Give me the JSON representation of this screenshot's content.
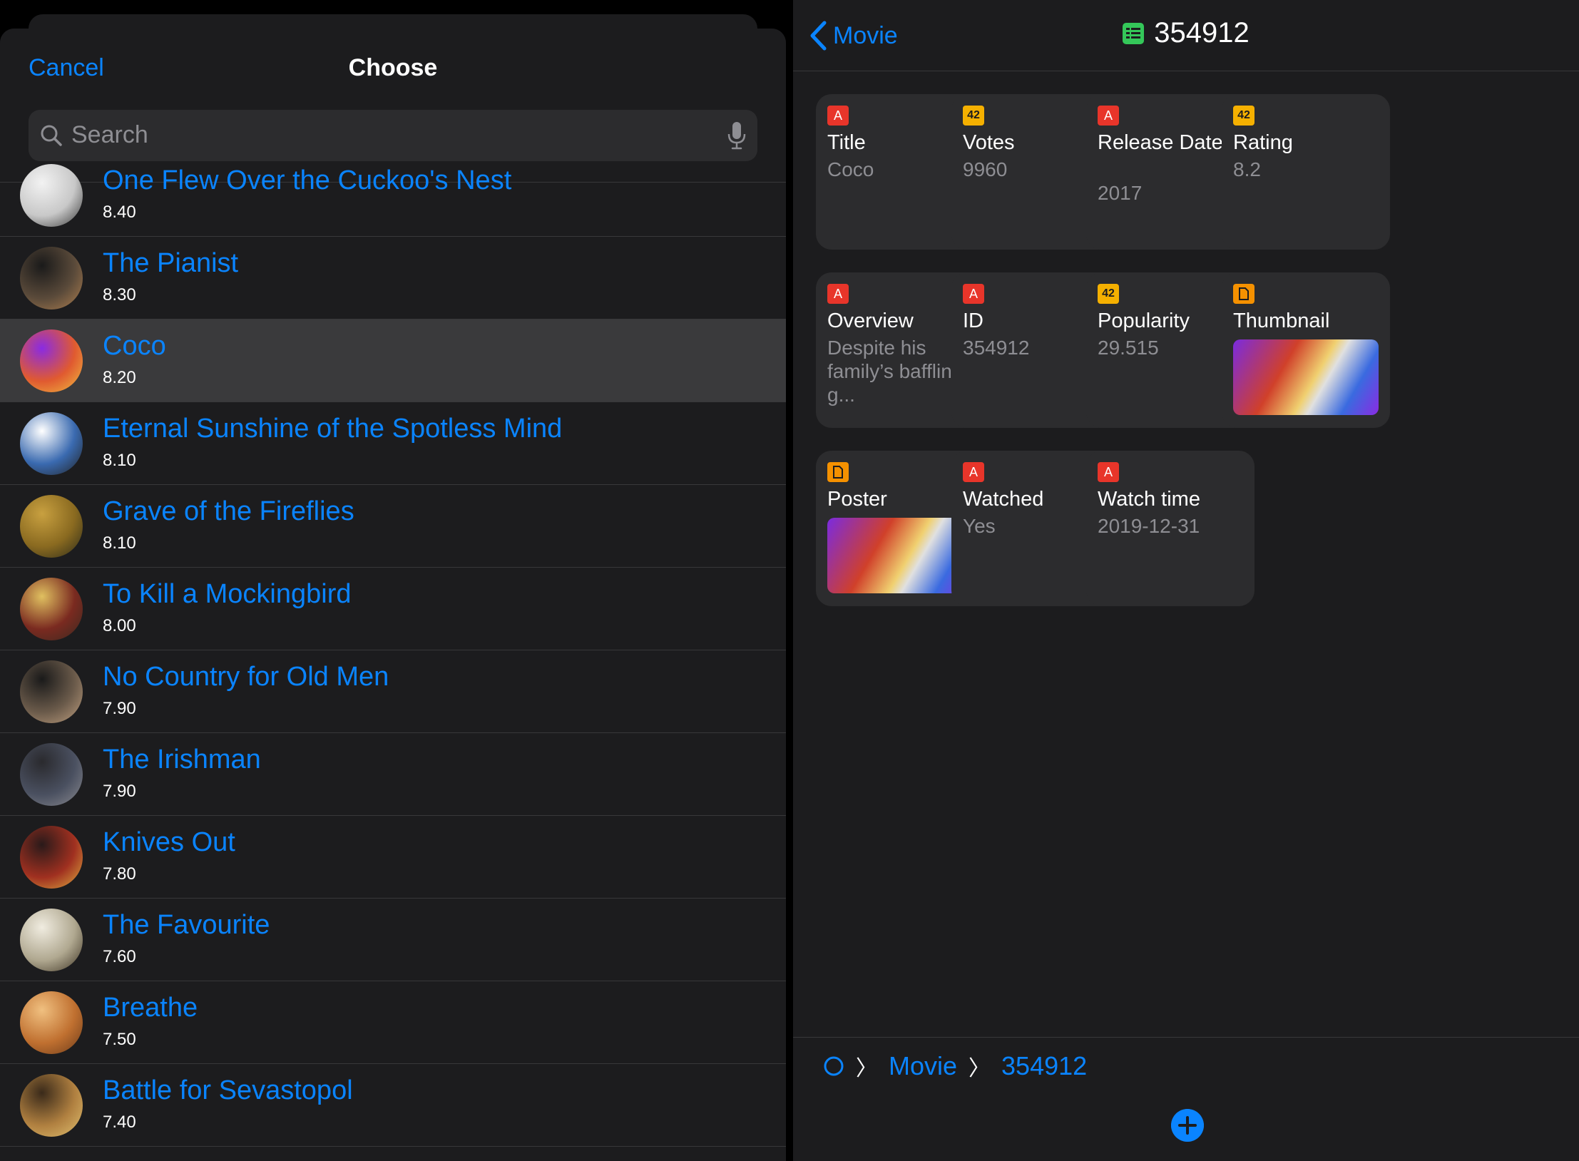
{
  "sheet": {
    "cancel_label": "Cancel",
    "title": "Choose",
    "search_placeholder": "Search"
  },
  "movies": [
    {
      "title": "One Flew Over the Cuckoo's Nest",
      "rating": "8.40",
      "colors": [
        "#f2f2f2",
        "#c8c8c8",
        "#333333"
      ]
    },
    {
      "title": "The Pianist",
      "rating": "8.30",
      "colors": [
        "#1a1a1a",
        "#5a4a3a",
        "#b08050"
      ]
    },
    {
      "title": "Coco",
      "rating": "8.20",
      "colors": [
        "#8a2be2",
        "#e05a30",
        "#f0c040"
      ]
    },
    {
      "title": "Eternal Sunshine of the Spotless Mind",
      "rating": "8.10",
      "colors": [
        "#ffffff",
        "#3a6ab0",
        "#222222"
      ]
    },
    {
      "title": "Grave of the Fireflies",
      "rating": "8.10",
      "colors": [
        "#c8a040",
        "#8a6a20",
        "#2a2a1a"
      ]
    },
    {
      "title": "To Kill a Mockingbird",
      "rating": "8.00",
      "colors": [
        "#e0c060",
        "#7a2a20",
        "#3a2a20"
      ]
    },
    {
      "title": "No Country for Old Men",
      "rating": "7.90",
      "colors": [
        "#1a1a1a",
        "#6a5a4a",
        "#c0a080"
      ]
    },
    {
      "title": "The Irishman",
      "rating": "7.90",
      "colors": [
        "#2a2a2e",
        "#4a5060",
        "#8a8a90"
      ]
    },
    {
      "title": "Knives Out",
      "rating": "7.80",
      "colors": [
        "#2a1a1a",
        "#a03020",
        "#e0b040"
      ]
    },
    {
      "title": "The Favourite",
      "rating": "7.60",
      "colors": [
        "#f0ece0",
        "#b0a890",
        "#3a3020"
      ]
    },
    {
      "title": "Breathe",
      "rating": "7.50",
      "colors": [
        "#f0c080",
        "#c07030",
        "#6a3a1a"
      ]
    },
    {
      "title": "Battle for Sevastopol",
      "rating": "7.40",
      "colors": [
        "#3a2a1a",
        "#b08040",
        "#e0c070"
      ]
    }
  ],
  "selected_index": 2,
  "detail": {
    "back_label": "Movie",
    "title": "354912",
    "fields": [
      {
        "type": "text",
        "badge": "A",
        "label": "Title",
        "value": "Coco"
      },
      {
        "type": "num",
        "badge": "42",
        "label": "Votes",
        "value": "9960"
      },
      {
        "type": "text",
        "badge": "A",
        "label": "Release Date",
        "value": "2017"
      },
      {
        "type": "num",
        "badge": "42",
        "label": "Rating",
        "value": "8.2"
      },
      {
        "type": "text",
        "badge": "A",
        "label": "Overview",
        "value": "Despite his family’s baffling g..."
      },
      {
        "type": "text",
        "badge": "A",
        "label": "ID",
        "value": "354912"
      },
      {
        "type": "num",
        "badge": "42",
        "label": "Popularity",
        "value": "29.515"
      },
      {
        "type": "file",
        "badge": "",
        "label": "Thumbnail",
        "value": ""
      },
      {
        "type": "file",
        "badge": "",
        "label": "Poster",
        "value": ""
      },
      {
        "type": "text",
        "badge": "A",
        "label": "Watched",
        "value": "Yes"
      },
      {
        "type": "text",
        "badge": "A",
        "label": "Watch time",
        "value": "2019-12-31"
      }
    ]
  },
  "breadcrumb": {
    "items": [
      "Movie",
      "354912"
    ]
  },
  "colors": {
    "accent": "#0a84ff",
    "background": "#1c1c1e",
    "card": "#2c2c2e",
    "badge_text": "#e8352a",
    "badge_number": "#f5b000",
    "badge_file": "#f59100"
  }
}
